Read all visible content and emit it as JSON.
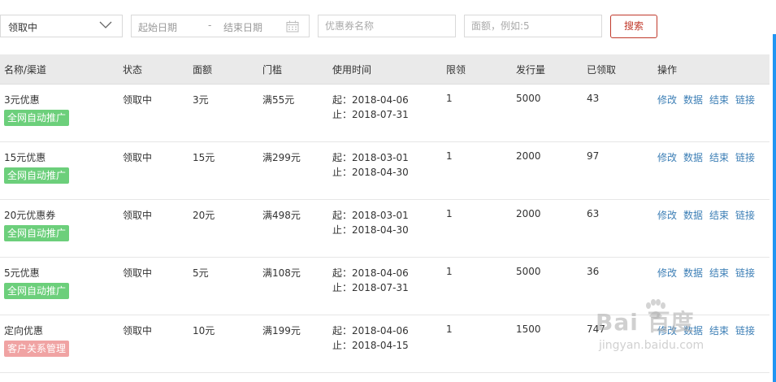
{
  "filters": {
    "status_select": "领取中",
    "date_start_placeholder": "起始日期",
    "date_separator": "-",
    "date_end_placeholder": "结束日期",
    "coupon_name_placeholder": "优惠券名称",
    "amount_placeholder": "面额，例如:5",
    "search_label": "搜索"
  },
  "table": {
    "headers": [
      "名称/渠道",
      "状态",
      "面额",
      "门槛",
      "使用时间",
      "限领",
      "发行量",
      "已领取",
      "操作"
    ],
    "rows": [
      {
        "name": "3元优惠",
        "tag": "全网自动推广",
        "tag_color": "#6ccf7b",
        "status": "领取中",
        "amount": "3元",
        "threshold": "满55元",
        "start": "起：2018-04-06",
        "end": "止：2018-07-31",
        "limit": "1",
        "issued": "5000",
        "claimed": "43"
      },
      {
        "name": "15元优惠",
        "tag": "全网自动推广",
        "tag_color": "#6ccf7b",
        "status": "领取中",
        "amount": "15元",
        "threshold": "满299元",
        "start": "起：2018-03-01",
        "end": "止：2018-04-30",
        "limit": "1",
        "issued": "2000",
        "claimed": "97"
      },
      {
        "name": "20元优惠券",
        "tag": "全网自动推广",
        "tag_color": "#6ccf7b",
        "status": "领取中",
        "amount": "20元",
        "threshold": "满498元",
        "start": "起：2018-03-01",
        "end": "止：2018-04-30",
        "limit": "1",
        "issued": "2000",
        "claimed": "63"
      },
      {
        "name": "5元优惠",
        "tag": "全网自动推广",
        "tag_color": "#6ccf7b",
        "status": "领取中",
        "amount": "5元",
        "threshold": "满108元",
        "start": "起：2018-04-06",
        "end": "止：2018-07-31",
        "limit": "1",
        "issued": "5000",
        "claimed": "36"
      },
      {
        "name": "定向优惠",
        "tag": "客户关系管理",
        "tag_color": "#f0a3a3",
        "status": "领取中",
        "amount": "10元",
        "threshold": "满199元",
        "start": "起：2018-04-06",
        "end": "止：2018-04-15",
        "limit": "1",
        "issued": "1500",
        "claimed": "747"
      }
    ],
    "actions": [
      "修改",
      "数据",
      "结束",
      "链接"
    ]
  },
  "watermark": {
    "logo": "Bai  百度",
    "site": "jingyan.baidu.com"
  },
  "colors": {
    "accent_blue": "#2196f3",
    "link": "#3d7fb6",
    "search_red": "#c0392b"
  }
}
